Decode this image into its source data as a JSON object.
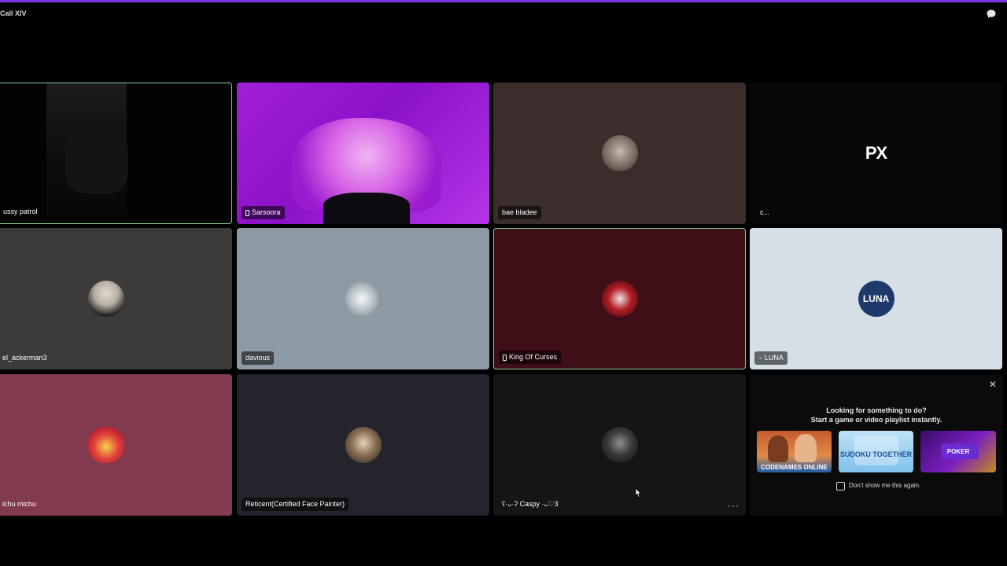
{
  "window": {
    "title": "Call XIV"
  },
  "colors": {
    "accent_bar": "#7c3aed",
    "speaking_border": "#7fcf8f"
  },
  "tiles": [
    {
      "name": "ussy patrol",
      "icon": "none"
    },
    {
      "name": "Sarsoora",
      "icon": "phone-icon"
    },
    {
      "name": "bae bladee",
      "icon": "none"
    },
    {
      "name": "c...",
      "icon": "none",
      "logo_text": "PX"
    },
    {
      "name": "el_ackerman3",
      "icon": "none"
    },
    {
      "name": "davious",
      "icon": "none"
    },
    {
      "name": "King Of Curses",
      "icon": "phone-icon"
    },
    {
      "name": "LUNA",
      "icon": "muted-icon",
      "logo_text": "LUNA"
    },
    {
      "name": "ichu michu",
      "icon": "none"
    },
    {
      "name": "Reticent(Certified Face Painter)",
      "icon": "none"
    },
    {
      "name": "ʕ·ᴗ·ʔ Caspy ·ᴗ♡3",
      "icon": "none",
      "more": "···"
    }
  ],
  "activity": {
    "line1": "Looking for something to do?",
    "line2": "Start a game or video playlist instantly.",
    "cards": [
      {
        "label": "CODENAMES ONLINE"
      },
      {
        "label": "SUDOKU TOGETHER"
      },
      {
        "label": "POKER"
      }
    ],
    "checkbox_label": "Don't show me this again.",
    "close": "✕"
  }
}
